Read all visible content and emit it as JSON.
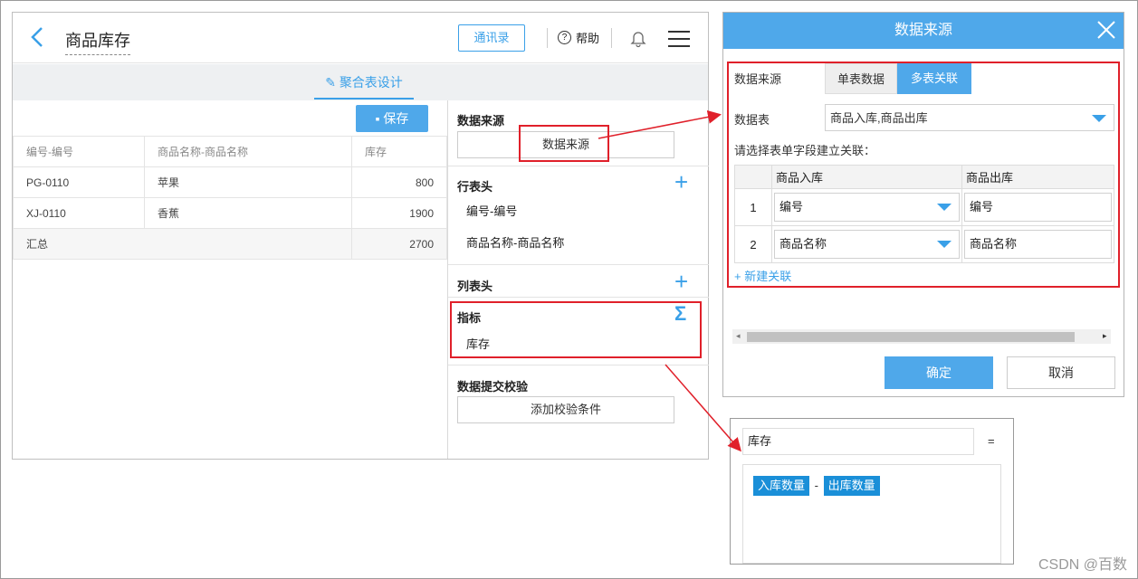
{
  "header": {
    "title": "商品库存",
    "contacts_btn": "通讯录",
    "help": "帮助"
  },
  "tab": {
    "label": "聚合表设计"
  },
  "toolbar": {
    "save": "保存"
  },
  "table": {
    "headers": [
      "编号-编号",
      "商品名称-商品名称",
      "库存"
    ],
    "rows": [
      [
        "PG-0110",
        "苹果",
        "800"
      ],
      [
        "XJ-0110",
        "香蕉",
        "1900"
      ]
    ],
    "total_label": "汇总",
    "total_value": "2700"
  },
  "sidebar": {
    "datasource_title": "数据来源",
    "datasource_btn": "数据来源",
    "row_header_title": "行表头",
    "row_header_items": [
      "编号-编号",
      "商品名称-商品名称"
    ],
    "col_header_title": "列表头",
    "metric_title": "指标",
    "metric_item": "库存",
    "validation_title": "数据提交校验",
    "validation_btn": "添加校验条件"
  },
  "dialog": {
    "title": "数据来源",
    "source_label": "数据来源",
    "seg_single": "单表数据",
    "seg_multi": "多表关联",
    "table_label": "数据表",
    "table_value": "商品入库,商品出库",
    "hint": "请选择表单字段建立关联：",
    "col_a": "商品入库",
    "col_b": "商品出库",
    "rows": [
      {
        "no": "1",
        "a": "编号",
        "b": "编号"
      },
      {
        "no": "2",
        "a": "商品名称",
        "b": "商品名称"
      }
    ],
    "add_link": "新建关联",
    "ok": "确定",
    "cancel": "取消"
  },
  "formula": {
    "name": "库存",
    "equals": "=",
    "token1": "入库数量",
    "operator": "-",
    "token2": "出库数量"
  },
  "watermark": "CSDN @百数",
  "colors": {
    "accent": "#4fa8ea",
    "highlight": "#e0202a"
  }
}
